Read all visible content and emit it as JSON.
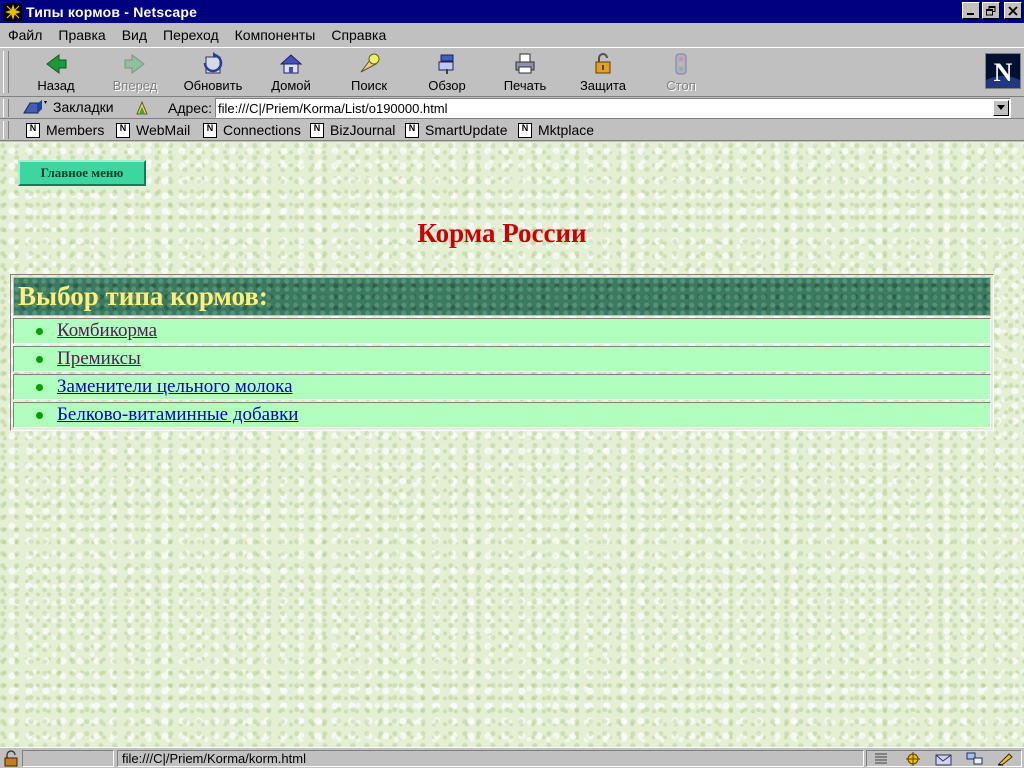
{
  "window": {
    "title": "Типы кормов - Netscape"
  },
  "menu": [
    {
      "label": "Файл"
    },
    {
      "label": "Правка"
    },
    {
      "label": "Вид"
    },
    {
      "label": "Переход"
    },
    {
      "label": "Компоненты"
    },
    {
      "label": "Справка"
    }
  ],
  "toolbar": {
    "back": {
      "label": "Назад",
      "icon": "back-arrow-icon",
      "enabled": true
    },
    "forward": {
      "label": "Вперед",
      "icon": "forward-arrow-icon",
      "enabled": false
    },
    "reload": {
      "label": "Обновить",
      "icon": "reload-icon",
      "enabled": true
    },
    "home": {
      "label": "Домой",
      "icon": "home-icon",
      "enabled": true
    },
    "search": {
      "label": "Поиск",
      "icon": "search-icon",
      "enabled": true
    },
    "guide": {
      "label": "Обзор",
      "icon": "guide-icon",
      "enabled": true
    },
    "print": {
      "label": "Печать",
      "icon": "print-icon",
      "enabled": true
    },
    "security": {
      "label": "Защита",
      "icon": "lock-icon",
      "enabled": true
    },
    "stop": {
      "label": "Стоп",
      "icon": "stop-icon",
      "enabled": false
    }
  },
  "location": {
    "bookmarks_label": "Закладки",
    "address_label": "Адрес:",
    "url": "file:///C|/Priem/Korma/List/o190000.html"
  },
  "personal_toolbar": [
    {
      "label": "Members"
    },
    {
      "label": "WebMail"
    },
    {
      "label": "Connections"
    },
    {
      "label": "BizJournal"
    },
    {
      "label": "SmartUpdate"
    },
    {
      "label": "Mktplace"
    }
  ],
  "content": {
    "main_menu_button": "Главное меню",
    "heading": "Корма России",
    "table_header": "Выбор типа кормов:",
    "items": [
      {
        "label": "Комбикорма",
        "visited": true
      },
      {
        "label": "Премиксы",
        "visited": true
      },
      {
        "label": "Заменители цельного молока",
        "visited": false
      },
      {
        "label": "Белково-витаминные добавки",
        "visited": false
      }
    ]
  },
  "status": {
    "text": "file:///C|/Priem/Korma/korm.html"
  },
  "colors": {
    "title_bar": "#000080",
    "heading": "#cc0000",
    "table_header_bg": "#3a7a60",
    "table_header_text": "#ffee77",
    "row_bg": "#b0ffbf",
    "button_bg": "#3cd6a0",
    "visited_link": "#551a55",
    "unvisited_link": "#0000cc"
  }
}
